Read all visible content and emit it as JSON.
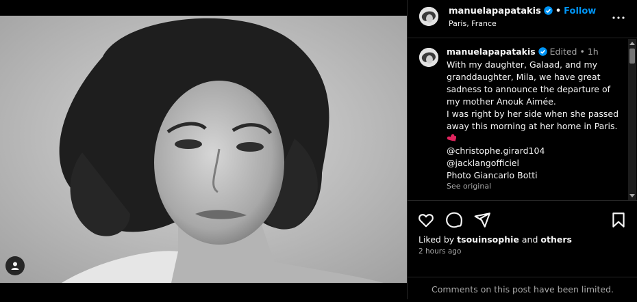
{
  "post": {
    "username": "manuelapapatakis",
    "follow_label": "Follow",
    "location": "Paris, France",
    "separator": "•"
  },
  "caption": {
    "username": "manuelapapatakis",
    "edited": "Edited",
    "time": "1h",
    "lines": [
      "With my daughter, Galaad, and my",
      "granddaughter, Mila, we have great",
      "sadness to announce the departure of",
      "my mother Anouk Aimée.",
      "I was right by her side when she passed",
      "away this morning at her home in Paris.",
      "@christophe.girard104",
      "@jacklangofficiel",
      "Photo Giancarlo Botti"
    ],
    "see_original": "See original"
  },
  "likes": {
    "prefix": "Liked by",
    "user": "tsouinsophie",
    "and": "and",
    "others": "others"
  },
  "timestamp": "2 hours ago",
  "comments_limited": "Comments on this post have been limited.",
  "colors": {
    "accent_blue": "#0095f6",
    "background": "#000000",
    "secondary_text": "#a8a8a8",
    "heart_emoji": "#e0245e"
  },
  "icons": [
    "more-icon",
    "verified-icon",
    "heart-icon",
    "comment-icon",
    "share-icon",
    "bookmark-icon",
    "tag-person-icon"
  ]
}
